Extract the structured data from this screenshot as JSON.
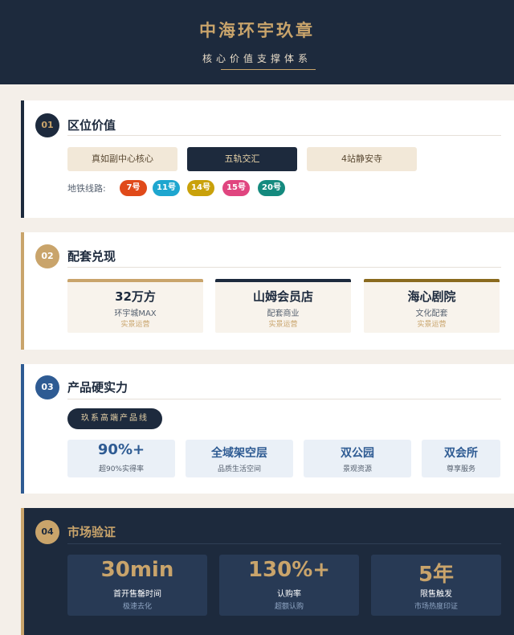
{
  "header": {
    "title": "中海环宇玖章",
    "subtitle": "核心价值支撑体系"
  },
  "sections": [
    {
      "number": "01",
      "title": "区位价值",
      "pills": [
        "真如副中心核心",
        "五轨交汇",
        "4站静安寺"
      ],
      "metro_label": "地铁线路:",
      "metro_lines": [
        {
          "label": "7号",
          "color": "#e04a1a"
        },
        {
          "label": "11号",
          "color": "#1ea6cf"
        },
        {
          "label": "14号",
          "color": "#c9a10a"
        },
        {
          "label": "15号",
          "color": "#e0457f"
        },
        {
          "label": "20号",
          "color": "#148a7e"
        }
      ]
    },
    {
      "number": "02",
      "title": "配套兑现",
      "items": [
        {
          "value": "32万方",
          "label": "环宇城MAX",
          "note": "实景运营",
          "accent": "#c9a46b"
        },
        {
          "value": "山姆会员店",
          "label": "配套商业",
          "note": "实景运营",
          "accent": "#1d2a3d"
        },
        {
          "value": "海心剧院",
          "label": "文化配套",
          "note": "实景运营",
          "accent": "#8a6a1e"
        }
      ]
    },
    {
      "number": "03",
      "title": "产品硬实力",
      "badge": "玖系高端产品线",
      "items": [
        {
          "value": "90%+",
          "label": "超90%实得率"
        },
        {
          "value": "全域架空层",
          "label": "品质生活空间"
        },
        {
          "value": "双公园",
          "label": "景观资源"
        },
        {
          "value": "双会所",
          "label": "尊享服务"
        }
      ]
    },
    {
      "number": "04",
      "title": "市场验证",
      "items": [
        {
          "value": "30min",
          "label": "首开售罄时间",
          "note": "极速去化"
        },
        {
          "value": "130%+",
          "label": "认购率",
          "note": "超额认购"
        },
        {
          "value": "5年",
          "label": "限售触发",
          "note": "市场热度印证"
        }
      ]
    }
  ]
}
